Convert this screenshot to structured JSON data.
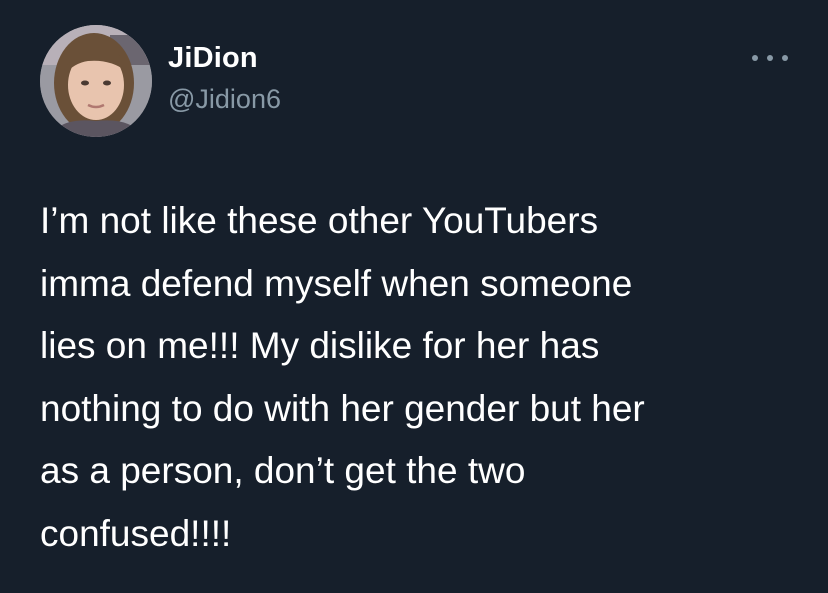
{
  "tweet": {
    "author_name": "JiDion",
    "author_handle": "@Jidion6",
    "more_icon": "more-horizontal-icon",
    "text_lines": [
      "I’m not like these other YouTubers",
      "imma defend myself when someone",
      "lies on me!!! My dislike for her has",
      "nothing to do with her gender but her",
      "as a person, don’t get the two",
      "confused!!!!"
    ]
  },
  "colors": {
    "background": "#15202b",
    "primary_text": "#ffffff",
    "secondary_text": "#8899a6"
  }
}
